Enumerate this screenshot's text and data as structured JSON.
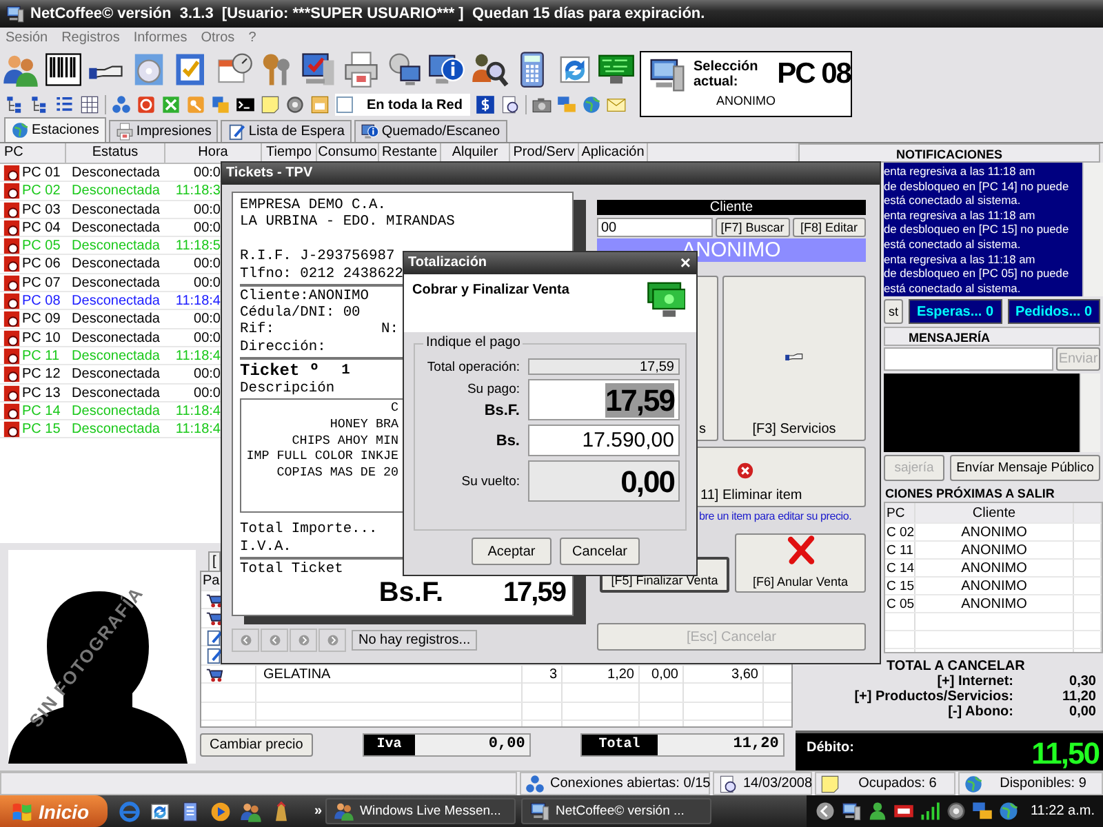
{
  "window": {
    "title": "NetCoffee© versión  3.1.3  [Usuario: ***SUPER USUARIO*** ]  Quedan 15 días para expiración."
  },
  "menu": [
    "Sesión",
    "Registros",
    "Informes",
    "Otros",
    "?"
  ],
  "network_toggle": {
    "label": "En toda la Red",
    "checked": false
  },
  "selection": {
    "label": "Selección actual:",
    "pc": "PC 08",
    "client": "ANONIMO"
  },
  "tabs": [
    {
      "label": "Estaciones",
      "selected": true
    },
    {
      "label": "Impresiones",
      "selected": false
    },
    {
      "label": "Lista de Espera",
      "selected": false
    },
    {
      "label": "Quemado/Escaneo",
      "selected": false
    }
  ],
  "stations": {
    "columns": [
      "PC",
      "Estatus",
      "Hora",
      "Tiempo",
      "Consumo",
      "Restante",
      "Alquiler",
      "Prod/Serv",
      "Aplicación"
    ],
    "rows": [
      {
        "pc": "PC 01",
        "status": "Desconectada",
        "time": "00:0",
        "color": "#000000"
      },
      {
        "pc": "PC 02",
        "status": "Desconectada",
        "time": "11:18:3",
        "color": "#19c819"
      },
      {
        "pc": "PC 03",
        "status": "Desconectada",
        "time": "00:0",
        "color": "#000000"
      },
      {
        "pc": "PC 04",
        "status": "Desconectada",
        "time": "00:0",
        "color": "#000000"
      },
      {
        "pc": "PC 05",
        "status": "Desconectada",
        "time": "11:18:5",
        "color": "#19c819"
      },
      {
        "pc": "PC 06",
        "status": "Desconectada",
        "time": "00:0",
        "color": "#000000"
      },
      {
        "pc": "PC 07",
        "status": "Desconectada",
        "time": "00:0",
        "color": "#000000"
      },
      {
        "pc": "PC 08",
        "status": "Desconectada",
        "time": "11:18:4",
        "color": "#1a1aff"
      },
      {
        "pc": "PC 09",
        "status": "Desconectada",
        "time": "00:0",
        "color": "#000000"
      },
      {
        "pc": "PC 10",
        "status": "Desconectada",
        "time": "00:0",
        "color": "#000000"
      },
      {
        "pc": "PC 11",
        "status": "Desconectada",
        "time": "11:18:4",
        "color": "#19c819"
      },
      {
        "pc": "PC 12",
        "status": "Desconectada",
        "time": "00:0",
        "color": "#000000"
      },
      {
        "pc": "PC 13",
        "status": "Desconectada",
        "time": "00:0",
        "color": "#000000"
      },
      {
        "pc": "PC 14",
        "status": "Desconectada",
        "time": "11:18:4",
        "color": "#19c819"
      },
      {
        "pc": "PC 15",
        "status": "Desconectada",
        "time": "11:18:4",
        "color": "#19c819"
      }
    ]
  },
  "photo": {
    "caption": "SIN FOTOGRAFÍA"
  },
  "products": {
    "tab": "[",
    "columns": [
      "Pa"
    ],
    "rows": [
      {
        "kind": "cart"
      },
      {
        "kind": "cart"
      },
      {
        "kind": "edit"
      },
      {
        "kind": "edit"
      },
      {
        "kind": "cart",
        "cells": [
          "GELATINA",
          "3",
          "1,20",
          "0,00",
          "3,60"
        ]
      }
    ],
    "change_price": "Cambiar precio",
    "iva_label": "Iva",
    "iva": "0,00",
    "total_label": "Total",
    "total": "11,20"
  },
  "notifications": {
    "title": "NOTIFICACIONES",
    "lines": [
      "enta regresiva a las 11:18 am",
      "de desbloqueo en [PC 14] no puede",
      "está conectado al sistema.",
      "enta regresiva a las 11:18 am",
      "de desbloqueo en [PC 15] no puede",
      "está conectado al sistema.",
      "enta regresiva a las 11:18 am",
      "de desbloqueo en [PC 05] no puede",
      "está conectado al sistema."
    ]
  },
  "queue": [
    {
      "kind": "button",
      "label": "st"
    },
    {
      "kind": "counter",
      "label": "Esperas... 0"
    },
    {
      "kind": "counter",
      "label": "Pedidos... 0"
    }
  ],
  "messaging": {
    "title": "MENSAJERÍA",
    "send": {
      "label": "Enviar",
      "disabled": true
    },
    "buttons": [
      {
        "label": "sajería",
        "disabled": true
      },
      {
        "label": "Envíar Mensaje Público",
        "disabled": false
      }
    ]
  },
  "upcoming": {
    "title": "CIONES PRÓXIMAS A SALIR",
    "columns": [
      "PC",
      "Cliente"
    ],
    "rows": [
      [
        "C 02",
        "ANONIMO"
      ],
      [
        "C 11",
        "ANONIMO"
      ],
      [
        "C 14",
        "ANONIMO"
      ],
      [
        "C 15",
        "ANONIMO"
      ],
      [
        "C 05",
        "ANONIMO"
      ]
    ]
  },
  "totals": {
    "title": "TOTAL A CANCELAR",
    "lines": [
      {
        "label": "[+] Internet:",
        "value": "0,30"
      },
      {
        "label": "[+] Productos/Servicios:",
        "value": "11,20"
      },
      {
        "label": "[-] Abono:",
        "value": "0,00"
      }
    ],
    "debit_label": "Débito:",
    "debit": "11,50"
  },
  "tickets": {
    "title": "Tickets - TPV",
    "receipt": {
      "company": "EMPRESA DEMO C.A.",
      "address": "LA URBINA - EDO. MIRANDAS",
      "rif": "R.I.F. J-293756987",
      "phone": "Tlfno: 0212 2438622",
      "client": "Cliente:ANONIMO",
      "id": "Cédula/DNI: 00",
      "rif_label": "Rif:",
      "n_label": "N:",
      "direction": "Dirección:",
      "ticket_label": "Ticket º",
      "ticket_no": "1",
      "desc_label": "Descripción",
      "items": [
        "C",
        "HONEY BRA",
        "CHIPS AHOY MIN",
        "IMP FULL COLOR INKJE",
        "COPIAS MAS DE 20"
      ],
      "total_import": "Total Importe...",
      "iva": "I.V.A.",
      "total_label": "Total Ticket",
      "currency": "Bs.F.",
      "total": "17,59"
    },
    "nav": "No hay registros...",
    "client_header": "Cliente",
    "client_code": "00",
    "search": "[F7] Buscar",
    "edit": "[F8] Editar",
    "client_name": "ANONIMO",
    "products_button": "s",
    "services_button": "[F3] Servicios",
    "delete_button": "11] Eliminar item",
    "hint": "bre un item para editar su precio.",
    "finish_button": "[F5] Finalizar Venta",
    "void_button": "[F6] Anular Venta",
    "cancel": {
      "label": "[Esc] Cancelar",
      "disabled": true
    }
  },
  "payment": {
    "title": "Totalización",
    "close": "×",
    "heading": "Cobrar y Finalizar Venta",
    "group": "Indique el pago",
    "total_label": "Total operación:",
    "total": "17,59",
    "paid_label": "Su pago:",
    "paid_currency": "Bs.F.",
    "paid": "17,59",
    "old_currency": "Bs.",
    "paid_old": "17.590,00",
    "change_label": "Su vuelto:",
    "change": "0,00",
    "buttons": [
      "Aceptar",
      "Cancelar"
    ]
  },
  "status_bar": {
    "connections": "Conexiones abiertas: 0/15",
    "date": "14/03/2008",
    "busy": "Ocupados: 6",
    "free": "Disponibles: 9"
  },
  "taskbar": {
    "start": "Inicio",
    "more": "»",
    "tasks": [
      "Windows Live Messen...",
      "NetCoffee© versión ..."
    ],
    "clock": "11:22 a.m."
  }
}
